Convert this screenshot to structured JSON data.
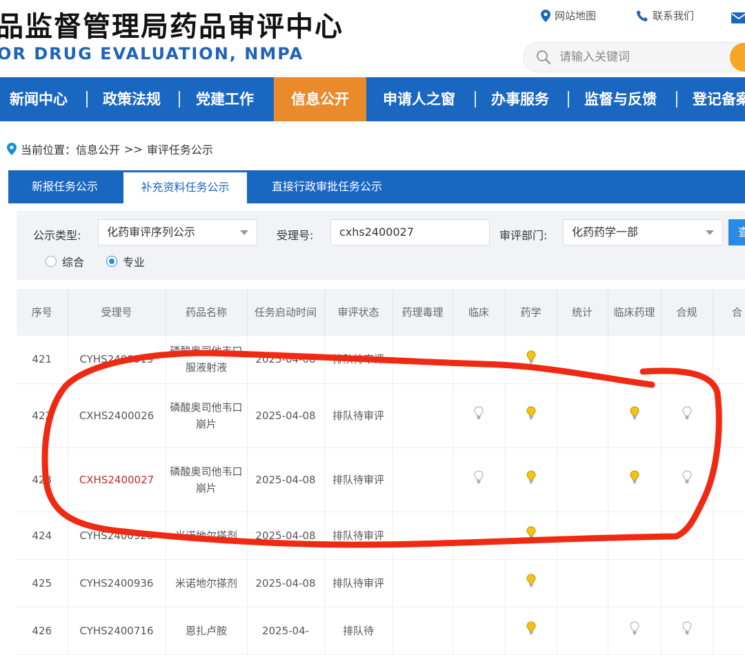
{
  "header": {
    "title_cn": "品监督管理局药品审评中心",
    "title_en": "OR DRUG EVALUATION, NMPA",
    "sitemap_label": "网站地图",
    "contact_label": "联系我们",
    "search_placeholder": "请输入关键词"
  },
  "nav": {
    "items": [
      {
        "label": "新闻中心"
      },
      {
        "label": "政策法规"
      },
      {
        "label": "党建工作"
      },
      {
        "label": "信息公开",
        "active": true
      },
      {
        "label": "申请人之窗"
      },
      {
        "label": "办事服务"
      },
      {
        "label": "监督与反馈"
      },
      {
        "label": "登记备案"
      }
    ]
  },
  "breadcrumb": {
    "prefix": "当前位置：",
    "level1": "信息公开",
    "separator": ">>",
    "level2": "审评任务公示"
  },
  "tabs": [
    {
      "label": "新报任务公示"
    },
    {
      "label": "补充资料任务公示",
      "active": true
    },
    {
      "label": "直接行政审批任务公示"
    }
  ],
  "filter": {
    "type_label": "公示类型:",
    "type_value": "化药审评序列公示",
    "accept_label": "受理号:",
    "accept_value": "cxhs2400027",
    "dept_label": "审评部门:",
    "dept_value": "化药药学一部",
    "query_label": "查",
    "radio_general": "综合",
    "radio_special": "专业",
    "radio_selected": "专业"
  },
  "table": {
    "headers": [
      "序号",
      "受理号",
      "药品名称",
      "任务启动时间",
      "审评状态",
      "药理毒理",
      "临床",
      "药学",
      "统计",
      "临床药理",
      "合规",
      "合"
    ],
    "rows": [
      {
        "no": "421",
        "accept": "CYHS2400919",
        "drug": "磷酸奥司他韦口服液射液",
        "date": "2025-04-08",
        "status": "排队待审评",
        "bulbs": [
          "",
          "",
          "on",
          "",
          "",
          ""
        ]
      },
      {
        "no": "422",
        "accept": "CXHS2400026",
        "drug": "磷酸奥司他韦口崩片",
        "date": "2025-04-08",
        "status": "排队待审评",
        "bulbs": [
          "",
          "off",
          "on",
          "",
          "on",
          "off"
        ]
      },
      {
        "no": "423",
        "accept": "CXHS2400027",
        "drug": "磷酸奥司他韦口崩片",
        "date": "2025-04-08",
        "status": "排队待审评",
        "bulbs": [
          "",
          "off",
          "on",
          "",
          "on",
          "off"
        ],
        "highlight": true
      },
      {
        "no": "424",
        "accept": "CYHS2400926",
        "drug": "米诺地尔搽剂",
        "date": "2025-04-08",
        "status": "排队待审评",
        "bulbs": [
          "",
          "",
          "on",
          "",
          "",
          ""
        ]
      },
      {
        "no": "425",
        "accept": "CYHS2400936",
        "drug": "米诺地尔搽剂",
        "date": "2025-04-08",
        "status": "排队待审评",
        "bulbs": [
          "",
          "",
          "on",
          "",
          "",
          ""
        ]
      },
      {
        "no": "426",
        "accept": "CYHS2400716",
        "drug": "恩扎卢胺",
        "date": "2025-04-",
        "status": "排队待",
        "bulbs": [
          "",
          "",
          "on",
          "",
          "off",
          "off"
        ]
      }
    ]
  },
  "colors": {
    "nav_bg": "#1a67c2",
    "nav_active": "#e98b2d",
    "title_en": "#1f63b8",
    "highlight_text": "#c0282d",
    "annotation": "#f02a12",
    "bulb_on": "#f1c21b",
    "bulb_off": "#d0d0d0"
  }
}
